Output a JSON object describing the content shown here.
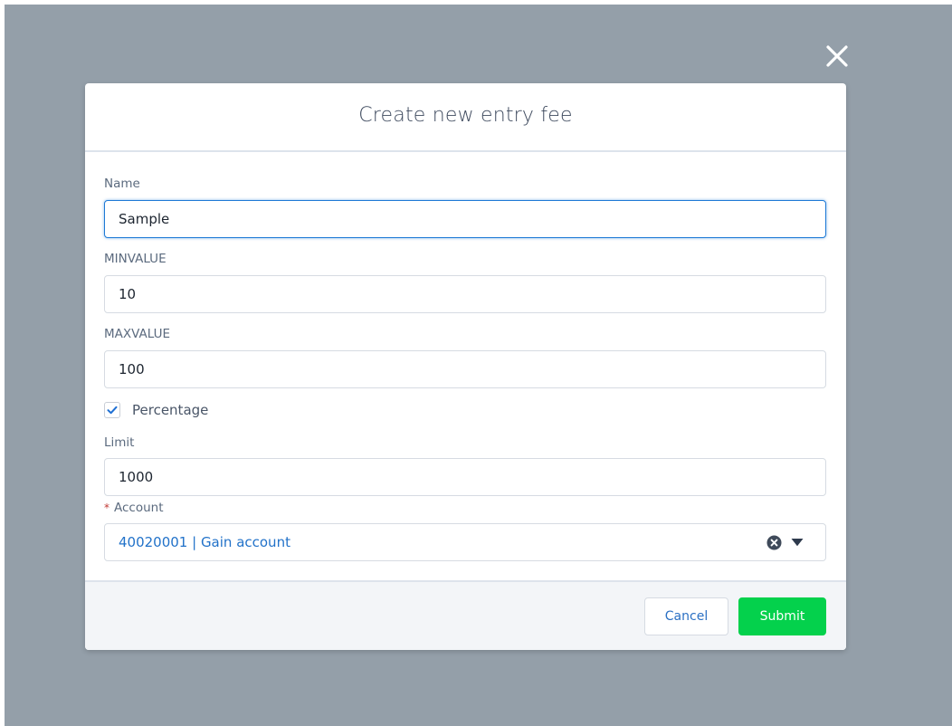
{
  "modal": {
    "title": "Create new entry fee"
  },
  "form": {
    "name": {
      "label": "Name",
      "value": "Sample"
    },
    "min_value": {
      "label": "MINVALUE",
      "value": "10"
    },
    "max_value": {
      "label": "MAXVALUE",
      "value": "100"
    },
    "percentage": {
      "label": "Percentage",
      "checked": true
    },
    "limit": {
      "label": "Limit",
      "value": "1000"
    },
    "account": {
      "required_mark": "*",
      "label": "Account",
      "value": "40020001 | Gain account"
    }
  },
  "footer": {
    "cancel_label": "Cancel",
    "submit_label": "Submit"
  },
  "icons": {
    "close": "close-icon",
    "checkmark": "checkmark-icon",
    "clear": "clear-circle-icon",
    "dropdown": "caret-down-icon"
  },
  "colors": {
    "backdrop": "#949fa9",
    "submit": "#04d14c",
    "link_blue": "#2272c9",
    "focus_blue": "#1e7ad6",
    "required_red": "#c23934"
  }
}
